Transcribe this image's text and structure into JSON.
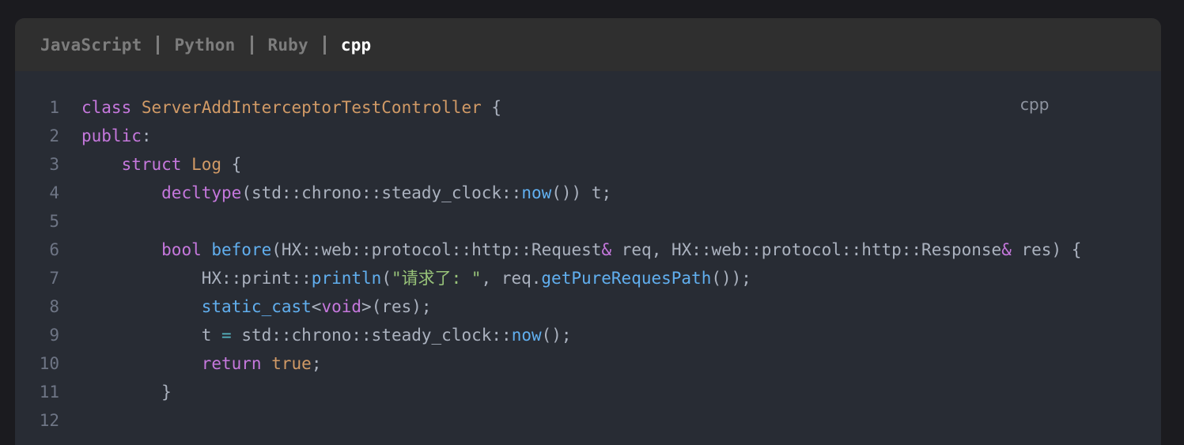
{
  "tabs": [
    {
      "label": "JavaScript",
      "active": false
    },
    {
      "label": "Python",
      "active": false
    },
    {
      "label": "Ruby",
      "active": false
    },
    {
      "label": "cpp",
      "active": true
    }
  ],
  "code": {
    "language_label": "cpp",
    "line_numbers": [
      "1",
      "2",
      "3",
      "4",
      "5",
      "6",
      "7",
      "8",
      "9",
      "10",
      "11",
      "12"
    ],
    "lines": [
      [
        {
          "t": "class ",
          "c": "kw"
        },
        {
          "t": "ServerAddInterceptorTestController",
          "c": "cls2"
        },
        {
          "t": " {",
          "c": "pl"
        }
      ],
      [
        {
          "t": "public",
          "c": "kw"
        },
        {
          "t": ":",
          "c": "pl"
        }
      ],
      [
        {
          "t": "    ",
          "c": "pl"
        },
        {
          "t": "struct ",
          "c": "kw"
        },
        {
          "t": "Log",
          "c": "cls2"
        },
        {
          "t": " {",
          "c": "pl"
        }
      ],
      [
        {
          "t": "        ",
          "c": "pl"
        },
        {
          "t": "decltype",
          "c": "kw"
        },
        {
          "t": "(std::chrono::steady_clock::",
          "c": "pl"
        },
        {
          "t": "now",
          "c": "fn"
        },
        {
          "t": "()) t;",
          "c": "pl"
        }
      ],
      [],
      [
        {
          "t": "        ",
          "c": "pl"
        },
        {
          "t": "bool ",
          "c": "kw"
        },
        {
          "t": "before",
          "c": "fn"
        },
        {
          "t": "(HX::web::protocol::http::Request",
          "c": "pl"
        },
        {
          "t": "&",
          "c": "kw"
        },
        {
          "t": " req, HX::web::protocol::http::Response",
          "c": "pl"
        },
        {
          "t": "&",
          "c": "kw"
        },
        {
          "t": " res) {",
          "c": "pl"
        }
      ],
      [
        {
          "t": "            HX::print::",
          "c": "pl"
        },
        {
          "t": "println",
          "c": "fn"
        },
        {
          "t": "(",
          "c": "pl"
        },
        {
          "t": "\"请求了: \"",
          "c": "str"
        },
        {
          "t": ", req.",
          "c": "pl"
        },
        {
          "t": "getPureRequesPath",
          "c": "fn"
        },
        {
          "t": "());",
          "c": "pl"
        }
      ],
      [
        {
          "t": "            ",
          "c": "pl"
        },
        {
          "t": "static_cast",
          "c": "fn"
        },
        {
          "t": "<",
          "c": "pl"
        },
        {
          "t": "void",
          "c": "kw"
        },
        {
          "t": ">",
          "c": "pl"
        },
        {
          "t": "(res);",
          "c": "pl"
        }
      ],
      [
        {
          "t": "            t ",
          "c": "pl"
        },
        {
          "t": "=",
          "c": "op"
        },
        {
          "t": " std::chrono::steady_clock::",
          "c": "pl"
        },
        {
          "t": "now",
          "c": "fn"
        },
        {
          "t": "();",
          "c": "pl"
        }
      ],
      [
        {
          "t": "            ",
          "c": "pl"
        },
        {
          "t": "return ",
          "c": "kw"
        },
        {
          "t": "true",
          "c": "cls2"
        },
        {
          "t": ";",
          "c": "pl"
        }
      ],
      [
        {
          "t": "        }",
          "c": "pl"
        }
      ],
      []
    ]
  },
  "colors": {
    "keyword": "#c678dd",
    "type": "#d19a66",
    "function": "#61afef",
    "string": "#98c379",
    "plain": "#abb2bf",
    "line_number": "#6e7585",
    "background": "#282c34",
    "tab_bar": "#2f2f2f"
  }
}
